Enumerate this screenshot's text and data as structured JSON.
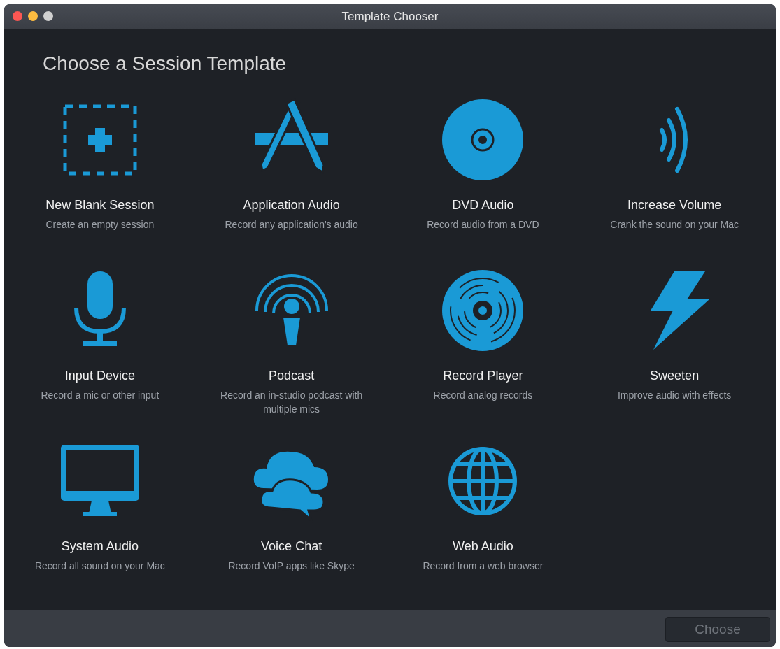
{
  "window": {
    "title": "Template Chooser"
  },
  "heading": "Choose a Session Template",
  "templates": [
    {
      "kind": "blank",
      "title": "New Blank Session",
      "subtitle": "Create an empty session"
    },
    {
      "kind": "application",
      "title": "Application Audio",
      "subtitle": "Record any application's audio"
    },
    {
      "kind": "dvd",
      "title": "DVD Audio",
      "subtitle": "Record audio from a DVD"
    },
    {
      "kind": "volume",
      "title": "Increase Volume",
      "subtitle": "Crank the sound on your Mac"
    },
    {
      "kind": "mic",
      "title": "Input Device",
      "subtitle": "Record a mic or other input"
    },
    {
      "kind": "podcast",
      "title": "Podcast",
      "subtitle": "Record an in-studio podcast with multiple mics"
    },
    {
      "kind": "record",
      "title": "Record Player",
      "subtitle": "Record analog records"
    },
    {
      "kind": "sweeten",
      "title": "Sweeten",
      "subtitle": "Improve audio with effects"
    },
    {
      "kind": "system",
      "title": "System Audio",
      "subtitle": "Record all sound on your Mac"
    },
    {
      "kind": "chat",
      "title": "Voice Chat",
      "subtitle": "Record VoIP apps like Skype"
    },
    {
      "kind": "web",
      "title": "Web Audio",
      "subtitle": "Record from a web browser"
    }
  ],
  "choose_button": {
    "label": "Choose",
    "disabled": true
  }
}
